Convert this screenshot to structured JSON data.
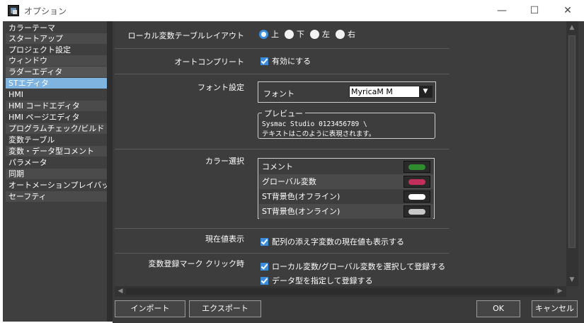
{
  "window": {
    "title": "オプション",
    "minimize_glyph": "—",
    "maximize_glyph": "☐",
    "close_glyph": "✕"
  },
  "nav": {
    "items": [
      {
        "label": "カラーテーマ"
      },
      {
        "label": "スタートアップ"
      },
      {
        "label": "プロジェクト設定"
      },
      {
        "label": "ウィンドウ"
      },
      {
        "label": "ラダーエディタ"
      },
      {
        "label": "STエディタ",
        "selected": true
      },
      {
        "label": "HMI"
      },
      {
        "label": "HMI コードエディタ"
      },
      {
        "label": "HMI ページエディタ"
      },
      {
        "label": "プログラムチェック/ビルド"
      },
      {
        "label": "変数テーブル"
      },
      {
        "label": "変数・データ型コメント"
      },
      {
        "label": "パラメータ"
      },
      {
        "label": "同期"
      },
      {
        "label": "オートメーションプレイバック"
      },
      {
        "label": "セーフティ"
      }
    ]
  },
  "settings": {
    "layout": {
      "label": "ローカル変数テーブルレイアウト",
      "options": [
        "上",
        "下",
        "左",
        "右"
      ],
      "selected": "上"
    },
    "autocomplete": {
      "label": "オートコンプリート",
      "checkbox_label": "有効にする",
      "checked": true
    },
    "font": {
      "label": "フォント設定",
      "field_label": "フォント",
      "value": "MyricaM M",
      "dropdown_glyph": "▼",
      "preview_title": "プレビュー",
      "preview_line1": "Sysmac Studio 0123456789 \\",
      "preview_line2": "テキストはこのように表現されます。"
    },
    "colors": {
      "label": "カラー選択",
      "rows": [
        {
          "name": "コメント",
          "color": "#2e8b2e"
        },
        {
          "name": "グローバル変数",
          "color": "#c0305a"
        },
        {
          "name": "ST背景色(オフライン)",
          "color": "#ffffff"
        },
        {
          "name": "ST背景色(オンライン)",
          "color": "#c8c8c8"
        }
      ]
    },
    "current_value": {
      "label": "現在値表示",
      "checkbox_label": "配列の添え字変数の現在値も表示する",
      "checked": true
    },
    "var_register": {
      "label": "変数登録マーク クリック時",
      "option1": "ローカル変数/グローバル変数を選択して登録する",
      "option2": "データ型を指定して登録する",
      "checked1": true,
      "checked2": true
    }
  },
  "buttons": {
    "import": "インポート",
    "export": "エクスポート",
    "ok": "OK",
    "cancel": "キャンセル"
  }
}
